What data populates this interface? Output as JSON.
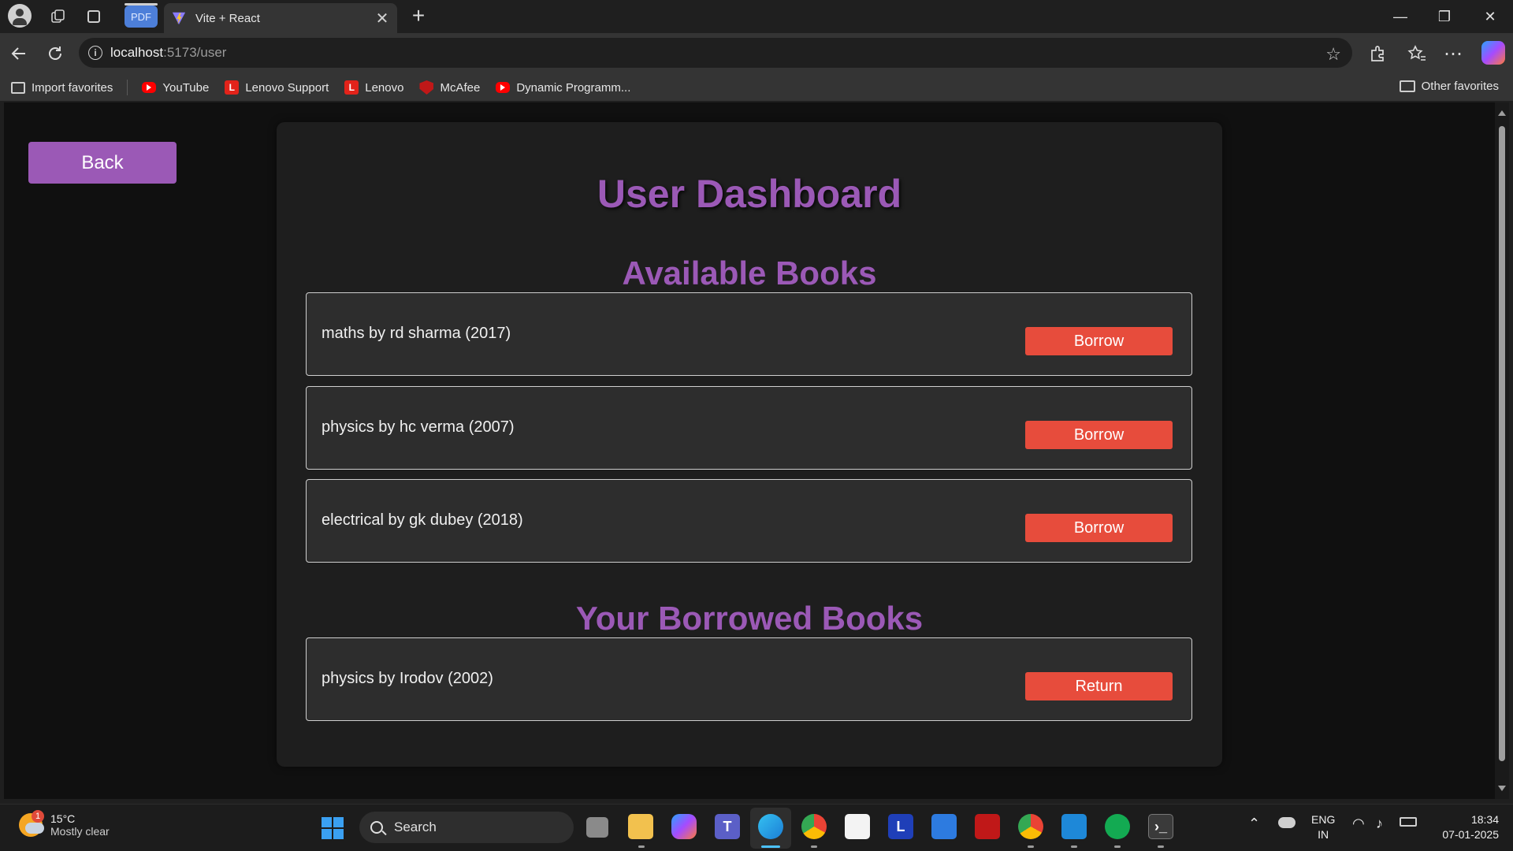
{
  "browser": {
    "pdf_tab_label": "PDF",
    "tab_title": "Vite + React",
    "tab_close": "✕",
    "new_tab": "+",
    "url_host": "localhost",
    "url_path": ":5173/user",
    "window_controls": {
      "minimize": "—",
      "restore": "❐",
      "close": "✕"
    }
  },
  "favorites": {
    "items": [
      {
        "label": "Import favorites",
        "icon": "import-icon"
      },
      {
        "label": "YouTube",
        "icon": "youtube-icon"
      },
      {
        "label": "Lenovo Support",
        "icon": "lenovo-icon"
      },
      {
        "label": "Lenovo",
        "icon": "lenovo-icon"
      },
      {
        "label": "McAfee",
        "icon": "mcafee-icon"
      },
      {
        "label": "Dynamic Programm...",
        "icon": "youtube-icon"
      }
    ],
    "other_label": "Other favorites"
  },
  "page": {
    "back_label": "Back",
    "title": "User Dashboard",
    "available_heading": "Available Books",
    "available_books": [
      {
        "text": "maths by rd sharma (2017)",
        "action": "Borrow"
      },
      {
        "text": "physics by hc verma (2007)",
        "action": "Borrow"
      },
      {
        "text": "electrical by gk dubey (2018)",
        "action": "Borrow"
      }
    ],
    "borrowed_heading": "Your Borrowed Books",
    "borrowed_books": [
      {
        "text": "physics by Irodov (2002)",
        "action": "Return"
      }
    ],
    "colors": {
      "accent": "#9b59b6",
      "button_red": "#e74c3c",
      "card_bg": "#1e1e1e",
      "item_bg": "#2d2d2d"
    }
  },
  "taskbar": {
    "weather_temp": "15°C",
    "weather_desc": "Mostly clear",
    "weather_badge": "1",
    "search_label": "Search",
    "lang_line1": "ENG",
    "lang_line2": "IN",
    "time": "18:34",
    "date": "07-01-2025"
  }
}
